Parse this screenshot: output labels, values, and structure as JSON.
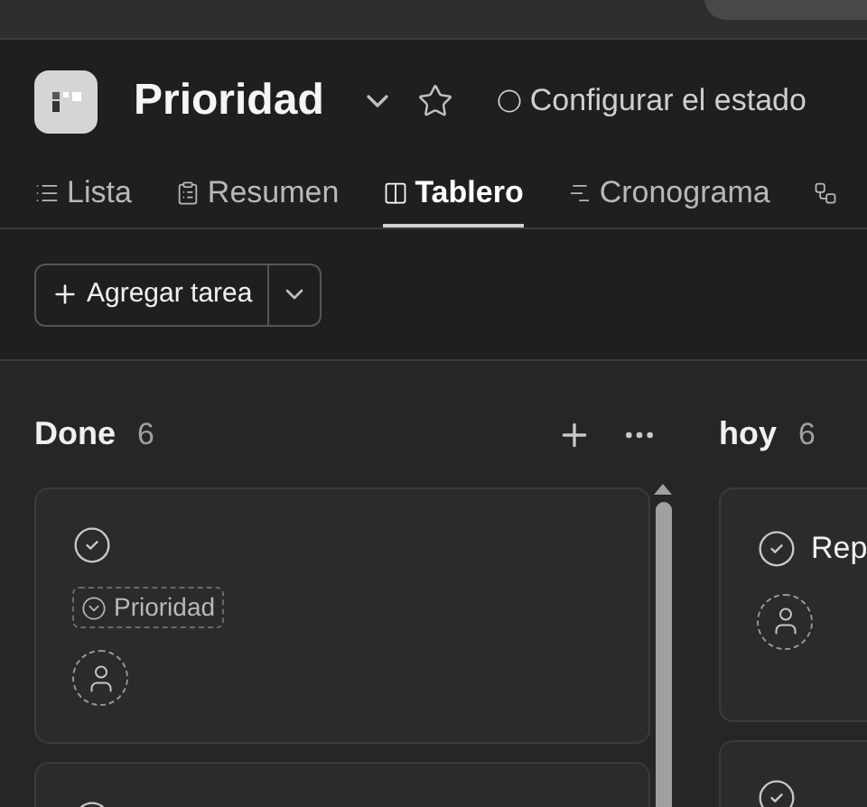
{
  "project": {
    "title": "Prioridad",
    "status": "Configurar el estado"
  },
  "tabs": [
    {
      "label": "Lista",
      "selected": false
    },
    {
      "label": "Resumen",
      "selected": false
    },
    {
      "label": "Tablero",
      "selected": true
    },
    {
      "label": "Cronograma",
      "selected": false
    },
    {
      "selected": false
    }
  ],
  "add_task": {
    "label": "Agregar tarea"
  },
  "columns": [
    {
      "name": "Done",
      "count": "6",
      "cards": [
        {
          "kind": "task",
          "tag": "Prioridad",
          "assignee": true
        },
        {
          "kind": "task"
        }
      ]
    },
    {
      "name": "hoy",
      "count": "6",
      "cards": [
        {
          "kind": "task",
          "title": "Rep",
          "assignee": true
        },
        {
          "kind": "task"
        }
      ]
    }
  ]
}
